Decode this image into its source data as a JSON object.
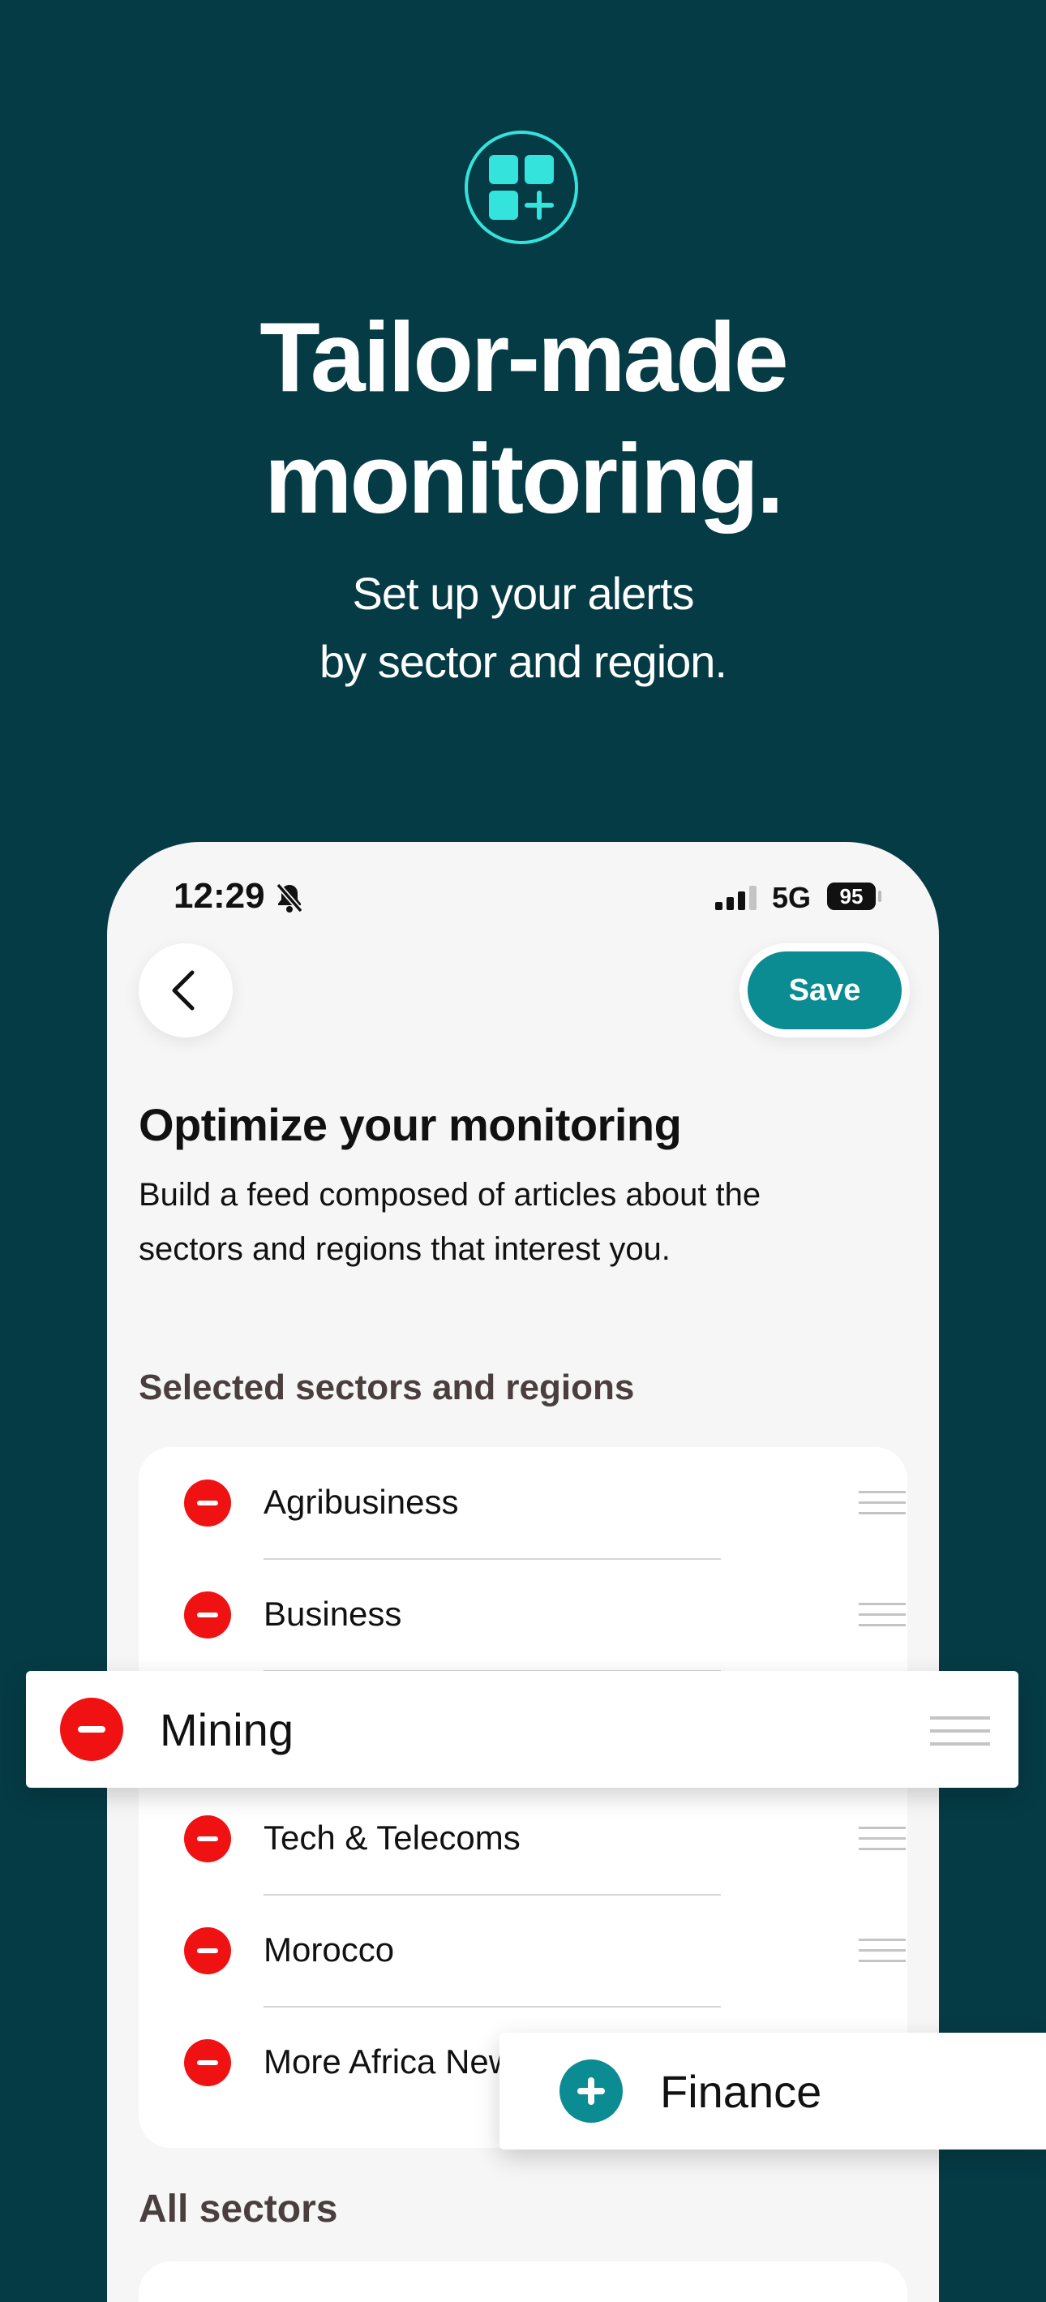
{
  "hero": {
    "icon": "dashboard-add-icon",
    "title_line1": "Tailor-made",
    "title_line2": "monitoring.",
    "subtitle_line1": "Set up your alerts",
    "subtitle_line2": "by sector and region."
  },
  "status_bar": {
    "time": "12:29",
    "network": "5G",
    "battery": "95"
  },
  "nav": {
    "save_label": "Save"
  },
  "page": {
    "title": "Optimize your monitoring",
    "description": "Build a feed composed of articles about the sectors and regions that interest you."
  },
  "selected": {
    "label": "Selected sectors and regions",
    "items": [
      {
        "label": "Agribusiness"
      },
      {
        "label": "Business"
      },
      {
        "label": "Mining"
      },
      {
        "label": "Tech & Telecoms"
      },
      {
        "label": "Morocco"
      },
      {
        "label": "More Africa New"
      }
    ]
  },
  "all_sectors": {
    "label": "All sectors"
  },
  "dragging": {
    "mining": "Mining",
    "finance": "Finance"
  },
  "colors": {
    "background": "#053b45",
    "accent": "#0b8b92",
    "icon_accent": "#34e3dc",
    "remove": "#f01212"
  }
}
